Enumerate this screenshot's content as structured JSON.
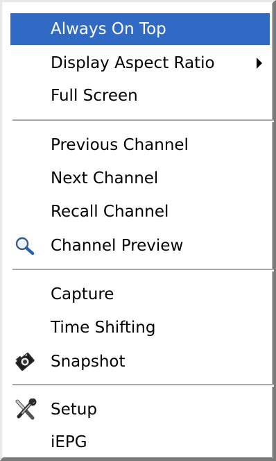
{
  "menu": {
    "items": [
      {
        "label": "Always On Top"
      },
      {
        "label": "Display Aspect Ratio"
      },
      {
        "label": "Full Screen"
      },
      {
        "label": "Previous Channel"
      },
      {
        "label": "Next Channel"
      },
      {
        "label": "Recall Channel"
      },
      {
        "label": "Channel Preview",
        "icon": "magnifier-icon"
      },
      {
        "label": "Capture"
      },
      {
        "label": "Time Shifting"
      },
      {
        "label": "Snapshot",
        "icon": "camera-icon"
      },
      {
        "label": "Setup",
        "icon": "tools-icon"
      },
      {
        "label": "iEPG"
      }
    ],
    "highlighted_item": "Always On Top",
    "submenu_item": "Display Aspect Ratio",
    "colors": {
      "highlight_background": "#316ac5",
      "highlight_text": "#ffffff",
      "text": "#000000",
      "separator": "#a8a8a8"
    }
  }
}
